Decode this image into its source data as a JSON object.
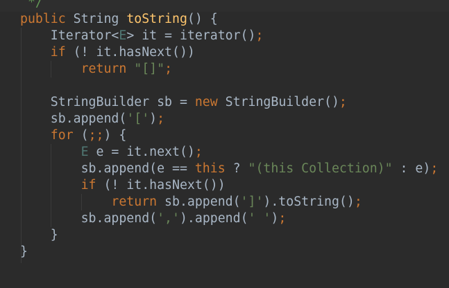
{
  "editor": {
    "colors": {
      "background": "#2b2b2b",
      "keyword": "#cc7832",
      "plain": "#a9b7c6",
      "method": "#ffc66d",
      "string": "#6a8759",
      "type_param": "#507874",
      "comment": "#629755"
    },
    "lines": [
      [
        [
          "cm",
          " */"
        ]
      ],
      [
        [
          "kw",
          "public "
        ],
        [
          "plain",
          "String "
        ],
        [
          "method",
          "toString"
        ],
        [
          "plain",
          "() {"
        ]
      ],
      [
        [
          "plain",
          "    Iterator<"
        ],
        [
          "tp",
          "E"
        ],
        [
          "plain",
          "> it = iterator()"
        ],
        [
          "semi",
          ";"
        ]
      ],
      [
        [
          "kw",
          "    if "
        ],
        [
          "plain",
          "(! it.hasNext())"
        ]
      ],
      [
        [
          "kw",
          "        return "
        ],
        [
          "str",
          "\"[]\""
        ],
        [
          "semi",
          ";"
        ]
      ],
      [],
      [
        [
          "plain",
          "    StringBuilder sb = "
        ],
        [
          "kw",
          "new "
        ],
        [
          "plain",
          "StringBuilder()"
        ],
        [
          "semi",
          ";"
        ]
      ],
      [
        [
          "plain",
          "    sb.append("
        ],
        [
          "str",
          "'['"
        ],
        [
          "plain",
          ")"
        ],
        [
          "semi",
          ";"
        ]
      ],
      [
        [
          "kw",
          "    for "
        ],
        [
          "plain",
          "("
        ],
        [
          "semi",
          ";;"
        ],
        [
          "plain",
          ") {"
        ]
      ],
      [
        [
          "tp",
          "        E "
        ],
        [
          "plain",
          "e = it.next()"
        ],
        [
          "semi",
          ";"
        ]
      ],
      [
        [
          "plain",
          "        sb.append(e == "
        ],
        [
          "kw",
          "this "
        ],
        [
          "plain",
          "? "
        ],
        [
          "str",
          "\"(this Collection)\""
        ],
        [
          "plain",
          " : e)"
        ],
        [
          "semi",
          ";"
        ]
      ],
      [
        [
          "kw",
          "        if "
        ],
        [
          "plain",
          "(! it.hasNext())"
        ]
      ],
      [
        [
          "kw",
          "            return "
        ],
        [
          "plain",
          "sb.append("
        ],
        [
          "str",
          "']'"
        ],
        [
          "plain",
          ").toString()"
        ],
        [
          "semi",
          ";"
        ]
      ],
      [
        [
          "plain",
          "        sb.append("
        ],
        [
          "str",
          "','"
        ],
        [
          "plain",
          ").append("
        ],
        [
          "str",
          "' '"
        ],
        [
          "plain",
          ")"
        ],
        [
          "semi",
          ";"
        ]
      ],
      [
        [
          "plain",
          "    }"
        ]
      ],
      [
        [
          "plain",
          "}"
        ]
      ]
    ]
  }
}
